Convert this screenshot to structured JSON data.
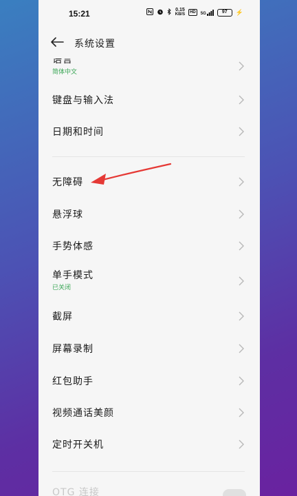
{
  "status": {
    "time": "15:21",
    "net_speed_top": "0.15",
    "net_speed_unit": "KB/S",
    "hd_label": "HD",
    "signal_label": "5G",
    "battery": "97"
  },
  "header": {
    "title": "系统设置"
  },
  "items": [
    {
      "label": "语言",
      "sub": "简体中文"
    },
    {
      "label": "键盘与输入法"
    },
    {
      "label": "日期和时间"
    },
    {
      "label": "无障碍"
    },
    {
      "label": "悬浮球"
    },
    {
      "label": "手势体感"
    },
    {
      "label": "单手模式",
      "sub": "已关闭"
    },
    {
      "label": "截屏"
    },
    {
      "label": "屏幕录制"
    },
    {
      "label": "红包助手"
    },
    {
      "label": "视频通话美颜"
    },
    {
      "label": "定时开关机"
    },
    {
      "label": "OTG 连接"
    }
  ],
  "colors": {
    "subtext": "#3aa655",
    "annotation_arrow": "#e53935"
  }
}
